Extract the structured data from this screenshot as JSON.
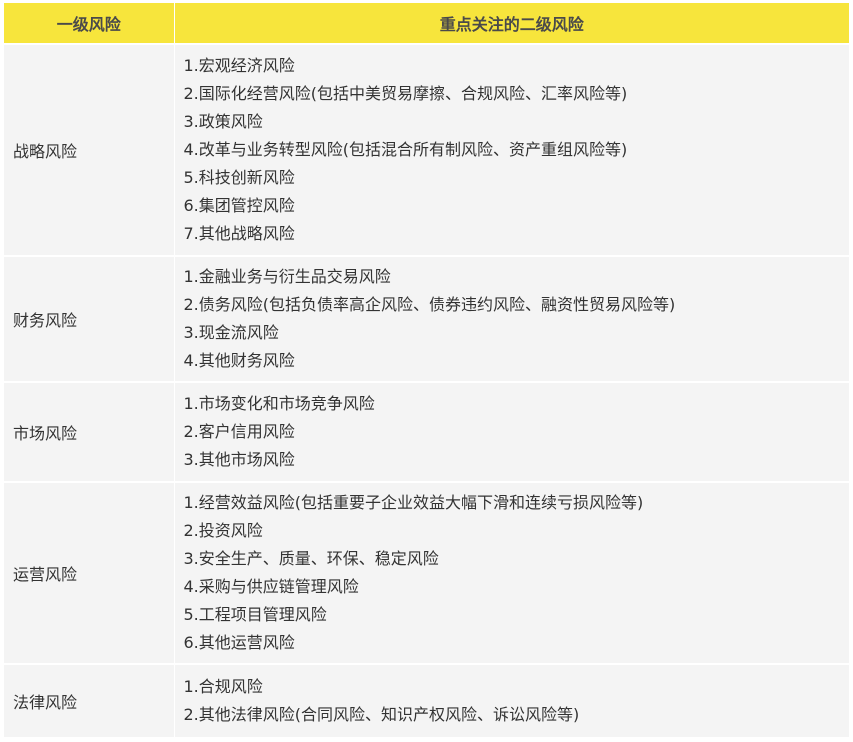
{
  "header": {
    "primary": "一级风险",
    "secondary": "重点关注的二级风险"
  },
  "rows": [
    {
      "primary": "战略风险",
      "items": [
        "1.宏观经济风险",
        "2.国际化经营风险(包括中美贸易摩擦、合规风险、汇率风险等)",
        "3.政策风险",
        "4.改革与业务转型风险(包括混合所有制风险、资产重组风险等)",
        "5.科技创新风险",
        "6.集团管控风险",
        "7.其他战略风险"
      ]
    },
    {
      "primary": "财务风险",
      "items": [
        "1.金融业务与衍生品交易风险",
        "2.债务风险(包括负债率高企风险、债券违约风险、融资性贸易风险等)",
        "3.现金流风险",
        "4.其他财务风险"
      ]
    },
    {
      "primary": "市场风险",
      "items": [
        "1.市场变化和市场竞争风险",
        "2.客户信用风险",
        "3.其他市场风险"
      ]
    },
    {
      "primary": "运营风险",
      "items": [
        "1.经营效益风险(包括重要子企业效益大幅下滑和连续亏损风险等)",
        "2.投资风险",
        "3.安全生产、质量、环保、稳定风险",
        "4.采购与供应链管理风险",
        "5.工程项目管理风险",
        "6.其他运营风险"
      ]
    },
    {
      "primary": "法律风险",
      "items": [
        "1.合规风险",
        "2.其他法律风险(合同风险、知识产权风险、诉讼风险等)"
      ]
    }
  ]
}
